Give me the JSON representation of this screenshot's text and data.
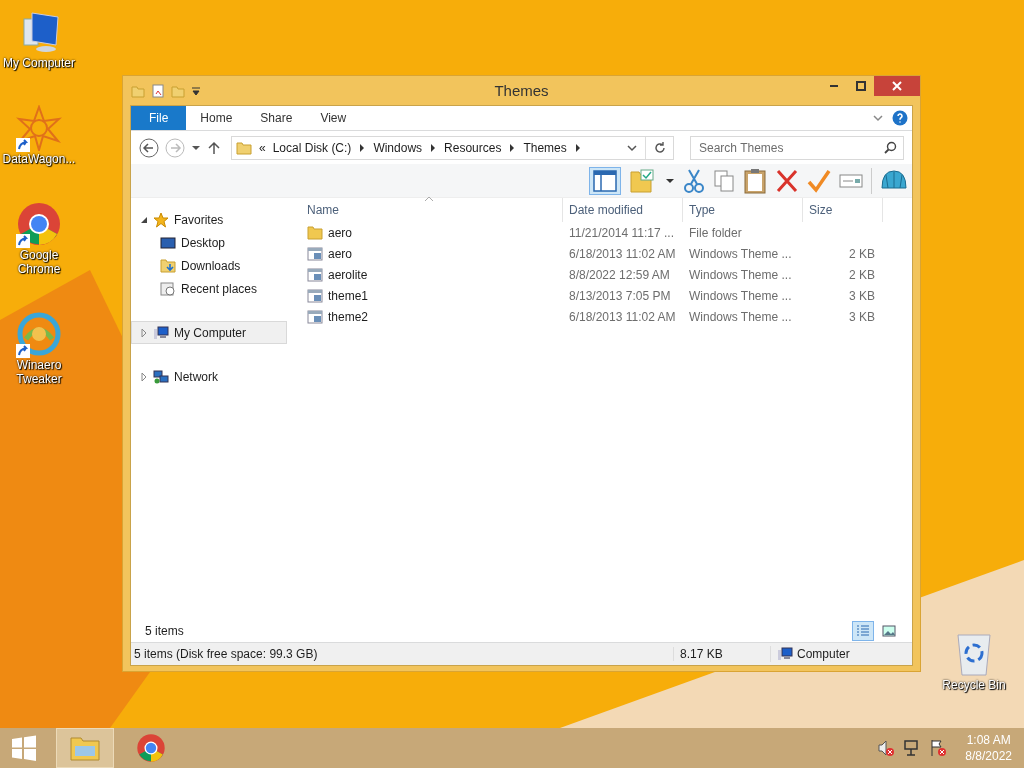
{
  "desktop_icons": [
    {
      "label": "My Computer",
      "kind": "computer",
      "shortcut": false
    },
    {
      "label": "DataWagon...",
      "kind": "datawagon",
      "shortcut": true
    },
    {
      "label": "Google Chrome",
      "kind": "chrome",
      "shortcut": true
    },
    {
      "label": "Winaero Tweaker",
      "kind": "winaero",
      "shortcut": true
    },
    {
      "label": "Recycle Bin",
      "kind": "recycle",
      "shortcut": false
    }
  ],
  "window": {
    "title": "Themes",
    "ribbon_tabs": [
      {
        "label": "File",
        "kind": "file",
        "selected": false
      },
      {
        "label": "Home",
        "kind": "tab",
        "selected": false
      },
      {
        "label": "Share",
        "kind": "tab",
        "selected": false
      },
      {
        "label": "View",
        "kind": "tab",
        "selected": false
      }
    ],
    "address": {
      "overflow": "«",
      "crumbs": [
        "Local Disk (C:)",
        "Windows",
        "Resources",
        "Themes"
      ]
    },
    "search": {
      "placeholder": "Search Themes"
    },
    "sidebar": [
      {
        "label": "Favorites",
        "kind": "favorites",
        "expanded": true,
        "selected": false,
        "children": [
          {
            "label": "Desktop",
            "kind": "desktop"
          },
          {
            "label": "Downloads",
            "kind": "downloads"
          },
          {
            "label": "Recent places",
            "kind": "recent"
          }
        ]
      },
      {
        "label": "My Computer",
        "kind": "computer",
        "expanded": false,
        "selected": true
      },
      {
        "label": "Network",
        "kind": "network",
        "expanded": false,
        "selected": false
      }
    ],
    "columns": [
      "Name",
      "Date modified",
      "Type",
      "Size"
    ],
    "rows": [
      {
        "name": "aero",
        "kind": "folder",
        "date": "11/21/2014 11:17 ...",
        "type": "File folder",
        "size": ""
      },
      {
        "name": "aero",
        "kind": "theme",
        "date": "6/18/2013 11:02 AM",
        "type": "Windows Theme ...",
        "size": "2 KB"
      },
      {
        "name": "aerolite",
        "kind": "theme",
        "date": "8/8/2022 12:59 AM",
        "type": "Windows Theme ...",
        "size": "2 KB"
      },
      {
        "name": "theme1",
        "kind": "theme",
        "date": "8/13/2013 7:05 PM",
        "type": "Windows Theme ...",
        "size": "3 KB"
      },
      {
        "name": "theme2",
        "kind": "theme",
        "date": "6/18/2013 11:02 AM",
        "type": "Windows Theme ...",
        "size": "3 KB"
      }
    ],
    "item_count": "5 items",
    "view_buttons": [
      {
        "kind": "details",
        "selected": true
      },
      {
        "kind": "large",
        "selected": false
      }
    ],
    "status_bar": {
      "summary": "5 items (Disk free space: 99.3 GB)",
      "size": "8.17 KB",
      "location": "Computer"
    }
  },
  "taskbar": {
    "apps": [
      {
        "kind": "explorer",
        "selected": true
      },
      {
        "kind": "chrome",
        "selected": false
      }
    ],
    "time": "1:08 AM",
    "date": "8/8/2022"
  }
}
